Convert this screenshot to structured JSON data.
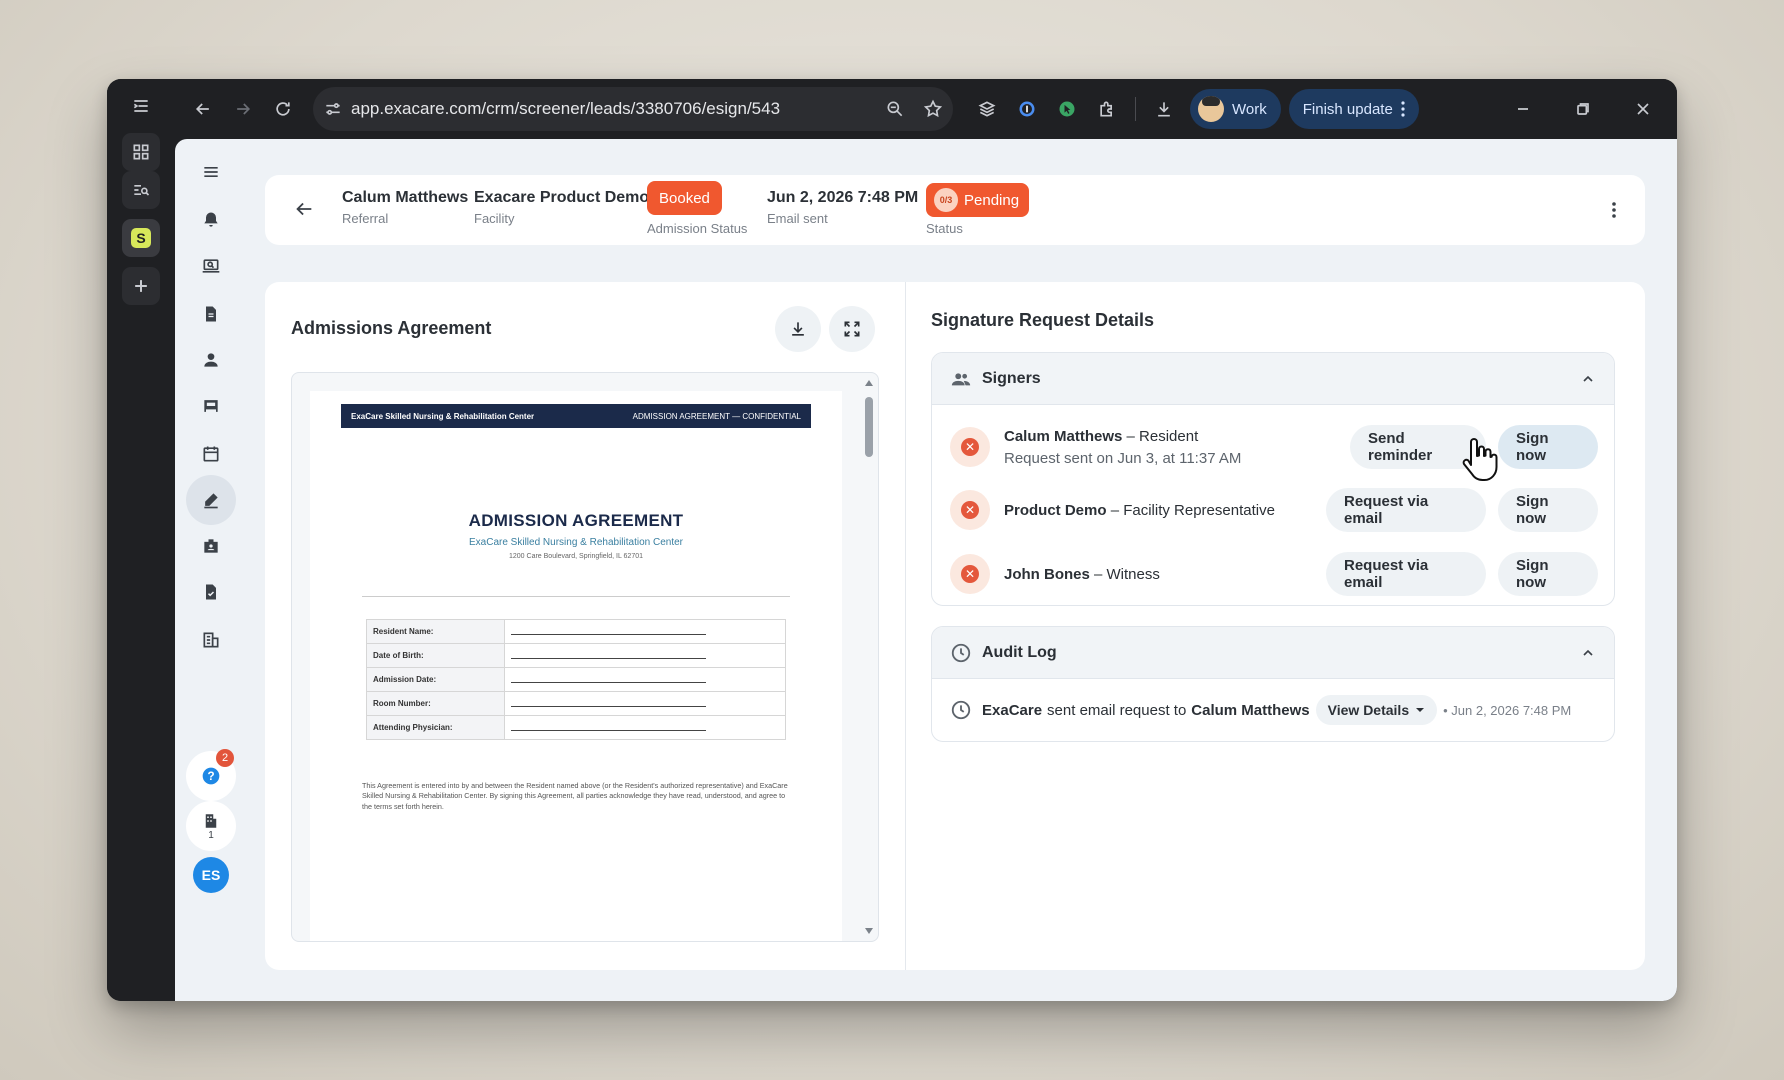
{
  "browser": {
    "url": "app.exacare.com/crm/screener/leads/3380706/esign/543",
    "profile_label": "Work",
    "finish_update_label": "Finish update"
  },
  "header": {
    "referral_name": "Calum Matthews",
    "referral_label": "Referral",
    "facility_name": "Exacare Product Demo",
    "facility_label": "Facility",
    "admission_status": "Booked",
    "admission_status_label": "Admission Status",
    "email_sent_date": "Jun 2, 2026 7:48 PM",
    "email_sent_label": "Email sent",
    "status_progress": "0/3",
    "status_value": "Pending",
    "status_label": "Status"
  },
  "colors": {
    "booked": "#f0582f",
    "pending": "#f0582f",
    "accent_blue": "#1e88e5"
  },
  "document": {
    "panel_title": "Admissions Agreement",
    "bar_left": "ExaCare Skilled Nursing & Rehabilitation Center",
    "bar_right": "ADMISSION AGREEMENT — CONFIDENTIAL",
    "title": "ADMISSION AGREEMENT",
    "subtitle": "ExaCare Skilled Nursing & Rehabilitation Center",
    "address": "1200 Care Boulevard, Springfield, IL 62701",
    "fields": [
      "Resident Name:",
      "Date of Birth:",
      "Admission Date:",
      "Room Number:",
      "Attending Physician:"
    ],
    "paragraph": "This Agreement is entered into by and between the Resident named above (or the Resident's authorized representative) and ExaCare Skilled Nursing & Rehabilitation Center. By signing this Agreement, all parties acknowledge they have read, understood, and agree to the terms set forth herein."
  },
  "signature": {
    "panel_title": "Signature Request Details",
    "signers_title": "Signers",
    "signers": [
      {
        "name": "Calum Matthews",
        "role": "– Resident",
        "sub": "Request sent on Jun 3, at 11:37 AM",
        "action": "Send reminder",
        "sign": "Sign now"
      },
      {
        "name": "Product Demo",
        "role": "– Facility Representative",
        "sub": "",
        "action": "Request via email",
        "sign": "Sign now"
      },
      {
        "name": "John Bones",
        "role": "– Witness",
        "sub": "",
        "action": "Request via email",
        "sign": "Sign now"
      }
    ],
    "audit_title": "Audit Log",
    "audit_entry": {
      "actor": "ExaCare",
      "text": "sent email request to",
      "target": "Calum Matthews",
      "details_label": "View Details",
      "timestamp": "• Jun 2, 2026 7:48 PM"
    }
  },
  "sidebar": {
    "help_badge": "2",
    "org_count": "1",
    "user_initials": "ES"
  }
}
